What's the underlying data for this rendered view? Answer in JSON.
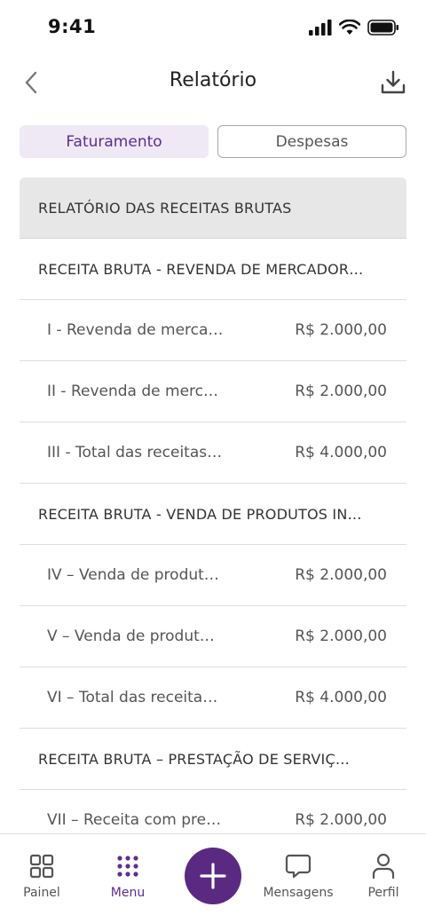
{
  "status_bar": {
    "time": "9:41"
  },
  "header": {
    "title": "Relatório"
  },
  "tabs": [
    {
      "label": "Faturamento",
      "active": true
    },
    {
      "label": "Despesas",
      "active": false
    }
  ],
  "report": {
    "header": "RELATÓRIO DAS RECEITAS BRUTAS",
    "sections": [
      {
        "title": "RECEITA BRUTA - REVENDA DE MERCADOR…",
        "items": [
          {
            "label": "I - Revenda de merca…",
            "value": "R$ 2.000,00"
          },
          {
            "label": "II - Revenda de merc…",
            "value": "R$ 2.000,00"
          },
          {
            "label": "III - Total das receitas…",
            "value": "R$ 4.000,00"
          }
        ]
      },
      {
        "title": "RECEITA BRUTA - VENDA DE PRODUTOS IN…",
        "items": [
          {
            "label": "IV – Venda de produt…",
            "value": "R$ 2.000,00"
          },
          {
            "label": "V – Venda de produt…",
            "value": "R$ 2.000,00"
          },
          {
            "label": "VI – Total das receita…",
            "value": "R$ 4.000,00"
          }
        ]
      },
      {
        "title": "RECEITA BRUTA – PRESTAÇÃO DE SERVIÇ…",
        "items": [
          {
            "label": "VII – Receita com pre…",
            "value": "R$ 2.000,00"
          }
        ]
      }
    ]
  },
  "bottom_nav": {
    "items": [
      {
        "label": "Painel",
        "icon": "grid-icon",
        "active": false
      },
      {
        "label": "Menu",
        "icon": "dots-grid-icon",
        "active": true
      },
      {
        "label": "Mensagens",
        "icon": "chat-icon",
        "active": false
      },
      {
        "label": "Perfil",
        "icon": "person-icon",
        "active": false
      }
    ],
    "fab_icon": "plus-icon"
  },
  "colors": {
    "accent": "#5a2a82",
    "active_tab_bg": "#efe8f5",
    "header_bg": "#e7e7e7"
  }
}
